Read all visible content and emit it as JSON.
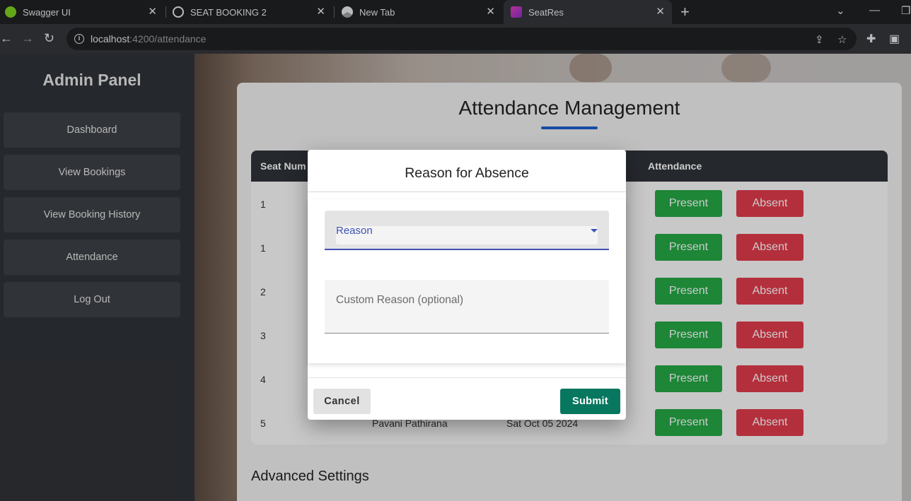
{
  "browser": {
    "tabs": [
      {
        "title": "Swagger UI",
        "icon": "swagger-favicon",
        "color": "#7ed321"
      },
      {
        "title": "SEAT BOOKING 2",
        "icon": "openai-favicon",
        "color": "#e8eaed"
      },
      {
        "title": "New Tab",
        "icon": "chrome-favicon",
        "color": "#e8eaed"
      },
      {
        "title": "SeatRes",
        "icon": "angular-favicon",
        "color": "#e23dba"
      }
    ],
    "url_host": "localhost",
    "url_path": ":4200/attendance"
  },
  "sidebar": {
    "title": "Admin Panel",
    "items": [
      {
        "label": "Dashboard"
      },
      {
        "label": "View Bookings"
      },
      {
        "label": "View Booking History"
      },
      {
        "label": "Attendance"
      },
      {
        "label": "Log Out"
      }
    ]
  },
  "main": {
    "title": "Attendance Management",
    "table": {
      "headers": [
        "Seat Num",
        "Attendance"
      ],
      "rows": [
        {
          "seat": "1",
          "name": "",
          "date": ""
        },
        {
          "seat": "1",
          "name": "",
          "date": ""
        },
        {
          "seat": "2",
          "name": "",
          "date": ""
        },
        {
          "seat": "3",
          "name": "",
          "date": ""
        },
        {
          "seat": "4",
          "name": "",
          "date": ""
        },
        {
          "seat": "5",
          "name": "Pavani Pathirana",
          "date": "Sat Oct 05 2024"
        }
      ],
      "present_label": "Present",
      "absent_label": "Absent"
    },
    "advanced_title": "Advanced Settings"
  },
  "dialog": {
    "title": "Reason for Absence",
    "reason_label": "Reason",
    "custom_label": "Custom Reason (optional)",
    "cancel_label": "Cancel",
    "submit_label": "Submit"
  },
  "colors": {
    "present": "#25a845",
    "absent": "#e23b4c",
    "submit": "#08775f",
    "accent": "#3f51b5"
  }
}
